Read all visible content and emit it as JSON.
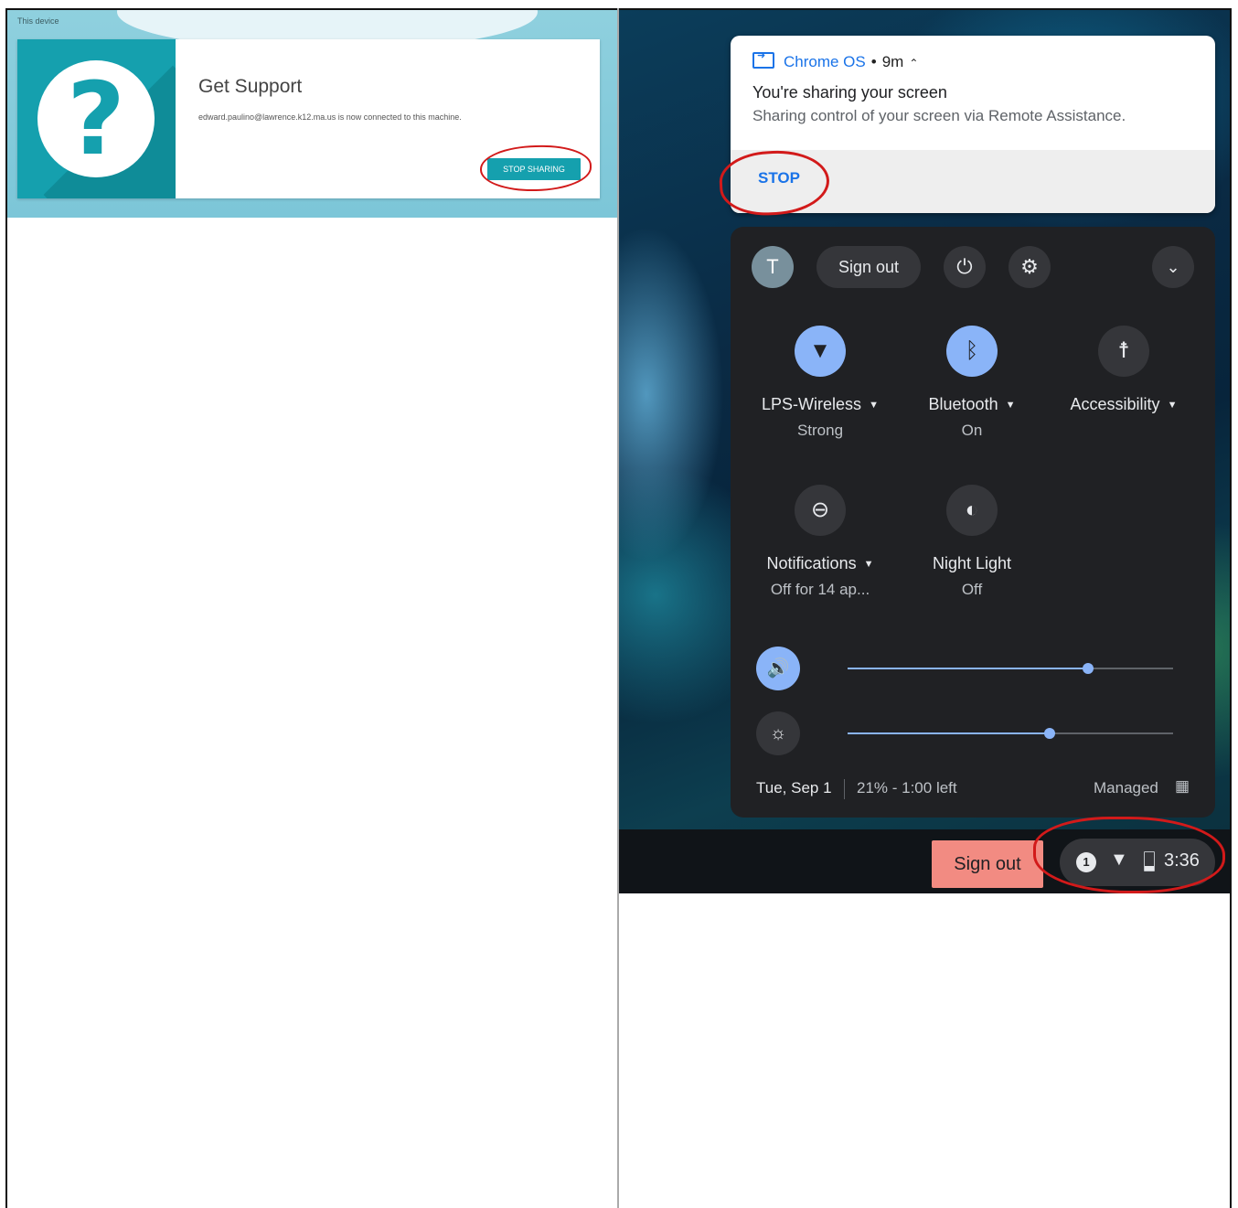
{
  "left": {
    "section_label": "This device",
    "card_title": "Get Support",
    "card_message": "edward.paulino@lawrence.k12.ma.us is now connected to this machine.",
    "stop_sharing_label": "STOP SHARING",
    "help_glyph": "?"
  },
  "notification": {
    "app_name": "Chrome OS",
    "separator": "•",
    "time": "9m",
    "title": "You're sharing your screen",
    "body": "Sharing control of your screen via Remote Assistance.",
    "stop_label": "STOP"
  },
  "quick_settings": {
    "avatar_letter": "T",
    "sign_out_label": "Sign out",
    "tiles": [
      {
        "label": "LPS-Wireless",
        "sub": "Strong",
        "icon": "wifi-locked-icon",
        "on": true,
        "has_menu": true
      },
      {
        "label": "Bluetooth",
        "sub": "On",
        "icon": "bluetooth-icon",
        "on": true,
        "has_menu": true
      },
      {
        "label": "Accessibility",
        "sub": "",
        "icon": "accessibility-icon",
        "on": false,
        "has_menu": true
      },
      {
        "label": "Notifications",
        "sub": "Off for 14 ap...",
        "icon": "do-not-disturb-icon",
        "on": false,
        "has_menu": true
      },
      {
        "label": "Night Light",
        "sub": "Off",
        "icon": "night-light-icon",
        "on": false,
        "has_menu": false
      }
    ],
    "volume_level": 0.74,
    "brightness_level": 0.62,
    "date": "Tue, Sep 1",
    "battery": "21% - 1:00 left",
    "managed_label": "Managed"
  },
  "shelf": {
    "sign_out_label": "Sign out",
    "notification_count": "1",
    "clock": "3:36"
  },
  "colors": {
    "teal_accent": "#15a0ae",
    "chrome_blue": "#1a73e8",
    "qs_background": "#202124",
    "toggle_on": "#8ab4f8",
    "sign_out_red": "#f28b82",
    "annotation_red": "#d21a1a"
  }
}
